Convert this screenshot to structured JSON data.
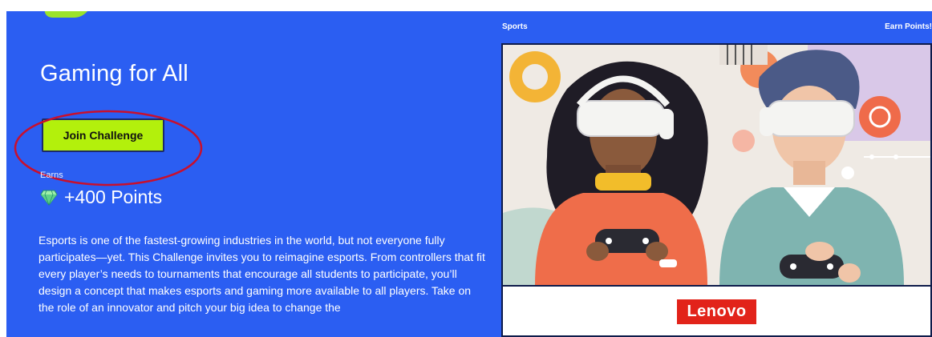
{
  "challenge": {
    "title": "Gaming for All",
    "join_label": "Join Challenge",
    "earns_label": "Earns",
    "points_label": "+400 Points",
    "description": "Esports is one of the fastest-growing industries in the world, but not everyone fully participates—yet. This Challenge invites you to reimagine esports. From controllers that fit every player’s needs to tournaments that encourage all students to participate, you’ll design a concept that makes esports and gaming more available to all players. Take on the role of an innovator and pitch your big idea to change the"
  },
  "card": {
    "category": "Sports",
    "earn_label": "Earn Points!",
    "sponsor": "Lenovo"
  },
  "colors": {
    "background": "#2b5ef2",
    "button": "#b3f00c",
    "annotation": "#c8102e",
    "sponsor": "#e2231a"
  },
  "icons": {
    "points": "gem-icon"
  }
}
